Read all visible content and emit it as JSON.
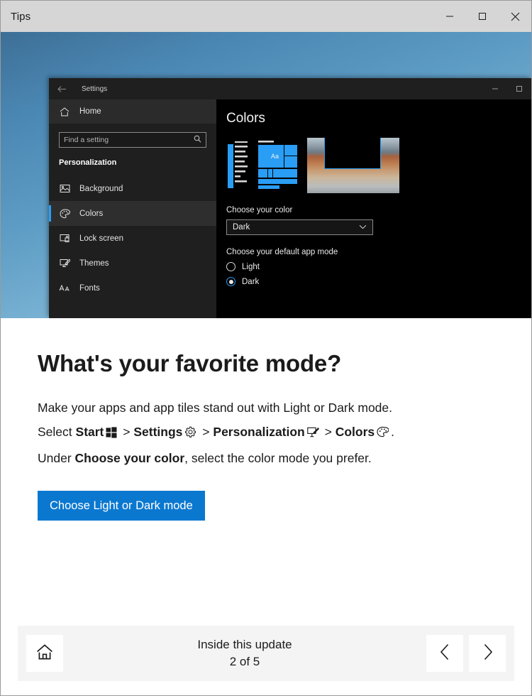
{
  "window": {
    "title": "Tips",
    "controls": [
      {
        "name": "minimize-button",
        "glyph": "minimize"
      },
      {
        "name": "maximize-button",
        "glyph": "maximize"
      },
      {
        "name": "close-button",
        "glyph": "close"
      }
    ]
  },
  "hero": {
    "settings": {
      "back_label": "back-arrow",
      "title": "Settings",
      "home_label": "Home",
      "search_placeholder": "Find a setting",
      "section_header": "Personalization",
      "nav_items": [
        {
          "label": "Background",
          "icon": "picture-icon",
          "selected": false
        },
        {
          "label": "Colors",
          "icon": "palette-icon",
          "selected": true
        },
        {
          "label": "Lock screen",
          "icon": "lock-screen-icon",
          "selected": false
        },
        {
          "label": "Themes",
          "icon": "themes-icon",
          "selected": false
        },
        {
          "label": "Fonts",
          "icon": "fonts-icon",
          "selected": false
        }
      ],
      "page_title": "Colors",
      "preview_tile_text": "Aa",
      "choose_color_label": "Choose your color",
      "choose_color_value": "Dark",
      "app_mode_label": "Choose your default app mode",
      "app_mode_options": [
        {
          "label": "Light",
          "selected": false
        },
        {
          "label": "Dark",
          "selected": true
        }
      ]
    }
  },
  "content": {
    "headline": "What's your favorite mode?",
    "line1": "Make your apps and app tiles stand out with Light or Dark mode.",
    "line2_select": "Select",
    "line2_start": "Start",
    "line2_sep1": ">",
    "line2_settings": "Settings",
    "line2_sep2": ">",
    "line2_personalization": "Personalization",
    "line2_sep3": ">",
    "line2_colors": "Colors",
    "line2_period": ".",
    "line3_prefix": "Under",
    "line3_bold": "Choose your color",
    "line3_suffix": ", select the color mode you prefer.",
    "cta_label": "Choose Light or Dark mode"
  },
  "bottom_bar": {
    "home_icon": "home-icon",
    "title": "Inside this update",
    "count": "2 of 5",
    "prev_icon": "chevron-left-icon",
    "next_icon": "chevron-right-icon"
  },
  "colors": {
    "accent_blue": "#0b78d0",
    "settings_accent": "#2a9df4",
    "titlebar_bg": "#d6d6d6",
    "bottom_bar_bg": "#f4f4f4",
    "text": "#1b1b1b"
  }
}
